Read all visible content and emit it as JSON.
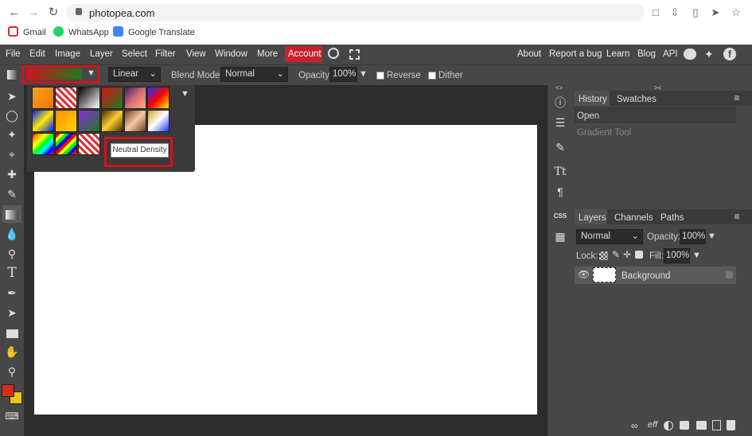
{
  "browser": {
    "url": "photopea.com",
    "bookmarks": [
      {
        "label": "Gmail",
        "icon": "gmail-icon"
      },
      {
        "label": "WhatsApp",
        "icon": "whatsapp-icon"
      },
      {
        "label": "Google Translate",
        "icon": "google-translate-icon"
      }
    ]
  },
  "menu": {
    "items": [
      "File",
      "Edit",
      "Image",
      "Layer",
      "Select",
      "Filter",
      "View",
      "Window",
      "More"
    ],
    "account": "Account",
    "right_links": [
      "About",
      "Report a bug",
      "Learn",
      "Blog",
      "API"
    ]
  },
  "options": {
    "gradient_type": "Linear",
    "blend_mode_label": "Blend Mode:",
    "blend_mode": "Normal",
    "opacity_label": "Opacity:",
    "opacity": "100%",
    "reverse_label": "Reverse",
    "dither_label": "Dither"
  },
  "gradient_popup": {
    "tooltip": "Neutral Density"
  },
  "history_panel": {
    "tabs": [
      "History",
      "Swatches"
    ],
    "items": [
      "Open",
      "Gradient Tool"
    ]
  },
  "layers_panel": {
    "tabs": [
      "Layers",
      "Channels",
      "Paths"
    ],
    "blend": "Normal",
    "opacity_label": "Opacity:",
    "opacity": "100%",
    "lock_label": "Lock:",
    "fill_label": "Fill:",
    "fill": "100%",
    "layer_name": "Background"
  },
  "colors": {
    "accent_red": "#d4121b",
    "foreground": "#d62c1f",
    "background": "#f0c21a"
  }
}
